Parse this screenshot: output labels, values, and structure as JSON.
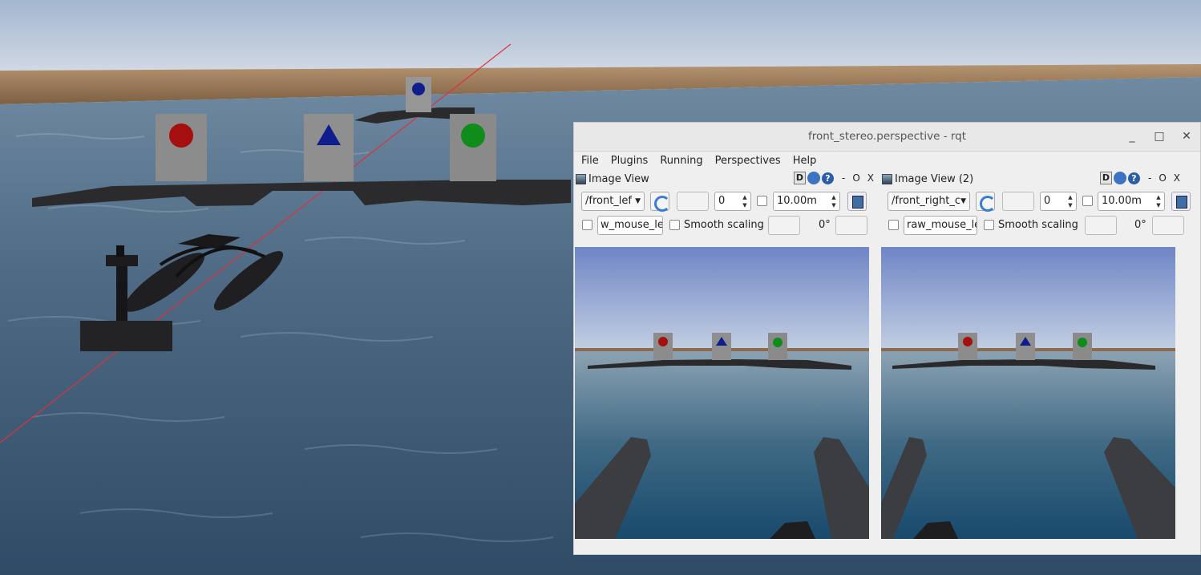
{
  "window": {
    "title": "front_stereo.perspective - rqt",
    "minimize_label": "_",
    "maximize_label": "□",
    "close_label": "✕"
  },
  "menu": {
    "file": "File",
    "plugins": "Plugins",
    "running": "Running",
    "perspectives": "Perspectives",
    "help": "Help"
  },
  "panes": [
    {
      "title": "Image View",
      "d_label": "D",
      "help_label": "?",
      "dash_label": "-",
      "o_label": "O",
      "x_label": "X",
      "topic": "/front_lef",
      "spin_value": "0",
      "distance": "10.00m",
      "mouse_topic": "w_mouse_left",
      "smooth_label": "Smooth scaling",
      "rotation": "0°"
    },
    {
      "title": "Image View (2)",
      "d_label": "D",
      "help_label": "?",
      "dash_label": "-",
      "o_label": "O",
      "x_label": "X",
      "topic": "/front_right_c",
      "spin_value": "0",
      "distance": "10.00m",
      "mouse_topic": "raw_mouse_left",
      "smooth_label": "Smooth scaling",
      "rotation": "0°"
    }
  ],
  "colors": {
    "sky_top": "#a9bdd6",
    "water": "#3c5a77",
    "shore": "#9c7a55",
    "target_red": "#a50f0f",
    "target_blue": "#0f1e8c",
    "target_green": "#0f8c1a",
    "accent_blue": "#3a7bd5"
  }
}
